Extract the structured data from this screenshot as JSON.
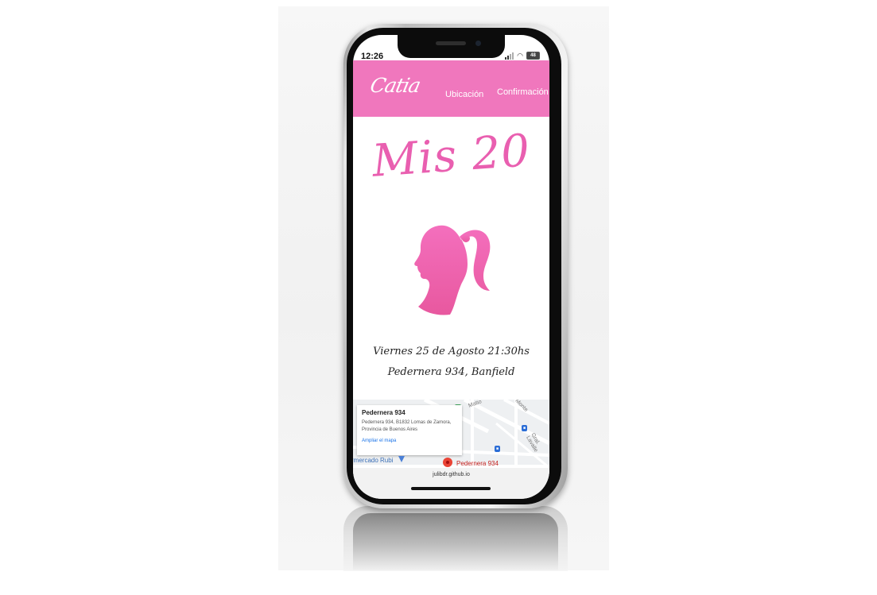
{
  "status_bar": {
    "time": "12:26",
    "battery": "48"
  },
  "navbar": {
    "logo": "Catia",
    "links": [
      "Ubicación",
      "Confirmación"
    ],
    "color": "#f077bd"
  },
  "hero": {
    "title": "Mis 20",
    "title_color": "#e95fb0",
    "icon": "girl-silhouette-icon"
  },
  "event": {
    "date": "Viernes 25 de Agosto 21:30hs",
    "place": "Pedernera 934, Banfield"
  },
  "map": {
    "card_title": "Pedernera 934",
    "card_address": "Pedernera 934, B1832 Lomas de Zamora, Provincia de Buenos Aires",
    "card_link": "Ampliar el mapa",
    "marker_label": "Pedernera 934",
    "left_label": "rmercado Rubi",
    "streets": [
      "Matio",
      "Monte",
      "Gral. Lavalle"
    ]
  },
  "browser": {
    "url": "julibdr.github.io"
  }
}
